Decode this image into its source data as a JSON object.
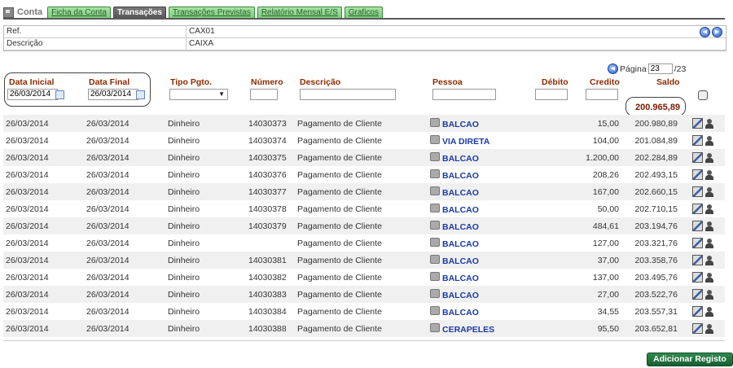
{
  "tabs": {
    "title": "Conta",
    "items": [
      {
        "label": "Ficha da Conta",
        "active": false
      },
      {
        "label": "Transações",
        "active": true
      },
      {
        "label": "Transações Previstas",
        "active": false
      },
      {
        "label": "Relatório Mensal E/S",
        "active": false
      },
      {
        "label": "Graficos",
        "active": false
      }
    ]
  },
  "info": {
    "ref_label": "Ref.",
    "ref_value": "CAX01",
    "desc_label": "Descrição",
    "desc_value": "CAIXA"
  },
  "pager": {
    "label": "Página",
    "current": "23",
    "total": "/23"
  },
  "headers": {
    "data_inicial": "Data Inicial",
    "data_final": "Data Final",
    "tipo_pgto": "Tipo Pgto.",
    "numero": "Número",
    "descricao": "Descrição",
    "pessoa": "Pessoa",
    "debito": "Débito",
    "credito": "Credito",
    "saldo": "Saldo"
  },
  "filters": {
    "data_inicial": "26/03/2014",
    "data_final": "26/03/2014",
    "tipo_pgto": "",
    "numero": "",
    "descricao": "",
    "pessoa": "",
    "debito": "",
    "credito": ""
  },
  "saldo_total": "200.965,89",
  "rows": [
    {
      "di": "26/03/2014",
      "df": "26/03/2014",
      "tipo": "Dinheiro",
      "num": "14030373",
      "desc": "Pagamento de Cliente",
      "pessoa": "BALCAO",
      "credito": "15,00",
      "saldo": "200.980,89"
    },
    {
      "di": "26/03/2014",
      "df": "26/03/2014",
      "tipo": "Dinheiro",
      "num": "14030374",
      "desc": "Pagamento de Cliente",
      "pessoa": "VIA DIRETA",
      "credito": "104,00",
      "saldo": "201.084,89"
    },
    {
      "di": "26/03/2014",
      "df": "26/03/2014",
      "tipo": "Dinheiro",
      "num": "14030375",
      "desc": "Pagamento de Cliente",
      "pessoa": "BALCAO",
      "credito": "1.200,00",
      "saldo": "202.284,89"
    },
    {
      "di": "26/03/2014",
      "df": "26/03/2014",
      "tipo": "Dinheiro",
      "num": "14030376",
      "desc": "Pagamento de Cliente",
      "pessoa": "BALCAO",
      "credito": "208,26",
      "saldo": "202.493,15"
    },
    {
      "di": "26/03/2014",
      "df": "26/03/2014",
      "tipo": "Dinheiro",
      "num": "14030377",
      "desc": "Pagamento de Cliente",
      "pessoa": "BALCAO",
      "credito": "167,00",
      "saldo": "202.660,15"
    },
    {
      "di": "26/03/2014",
      "df": "26/03/2014",
      "tipo": "Dinheiro",
      "num": "14030378",
      "desc": "Pagamento de Cliente",
      "pessoa": "BALCAO",
      "credito": "50,00",
      "saldo": "202.710,15"
    },
    {
      "di": "26/03/2014",
      "df": "26/03/2014",
      "tipo": "Dinheiro",
      "num": "14030379",
      "desc": "Pagamento de Cliente",
      "pessoa": "BALCAO",
      "credito": "484,61",
      "saldo": "203.194,76"
    },
    {
      "di": "26/03/2014",
      "df": "26/03/2014",
      "tipo": "Dinheiro",
      "num": "",
      "desc": "Pagamento de Cliente",
      "pessoa": "BALCAO",
      "credito": "127,00",
      "saldo": "203.321,76"
    },
    {
      "di": "26/03/2014",
      "df": "26/03/2014",
      "tipo": "Dinheiro",
      "num": "14030381",
      "desc": "Pagamento de Cliente",
      "pessoa": "BALCAO",
      "credito": "37,00",
      "saldo": "203.358,76"
    },
    {
      "di": "26/03/2014",
      "df": "26/03/2014",
      "tipo": "Dinheiro",
      "num": "14030382",
      "desc": "Pagamento de Cliente",
      "pessoa": "BALCAO",
      "credito": "137,00",
      "saldo": "203.495,76"
    },
    {
      "di": "26/03/2014",
      "df": "26/03/2014",
      "tipo": "Dinheiro",
      "num": "14030383",
      "desc": "Pagamento de Cliente",
      "pessoa": "BALCAO",
      "credito": "27,00",
      "saldo": "203.522,76"
    },
    {
      "di": "26/03/2014",
      "df": "26/03/2014",
      "tipo": "Dinheiro",
      "num": "14030384",
      "desc": "Pagamento de Cliente",
      "pessoa": "BALCAO",
      "credito": "34,55",
      "saldo": "203.557,31"
    },
    {
      "di": "26/03/2014",
      "df": "26/03/2014",
      "tipo": "Dinheiro",
      "num": "14030388",
      "desc": "Pagamento de Cliente",
      "pessoa": "CERAPELES",
      "credito": "95,50",
      "saldo": "203.652,81"
    }
  ],
  "icons": {
    "pessoa": "folder-icon",
    "edit": "edit-icon",
    "person": "person-icon",
    "nav_prev": "prev-circle-icon",
    "nav_next": "next-circle-icon"
  },
  "add_button": "Adicionar Registo",
  "colors": {
    "header_text": "#8b2b00",
    "link": "#1a3aa8",
    "tab_green": "#7ccc7c",
    "tab_active": "#555555",
    "button_green": "#185f31"
  }
}
